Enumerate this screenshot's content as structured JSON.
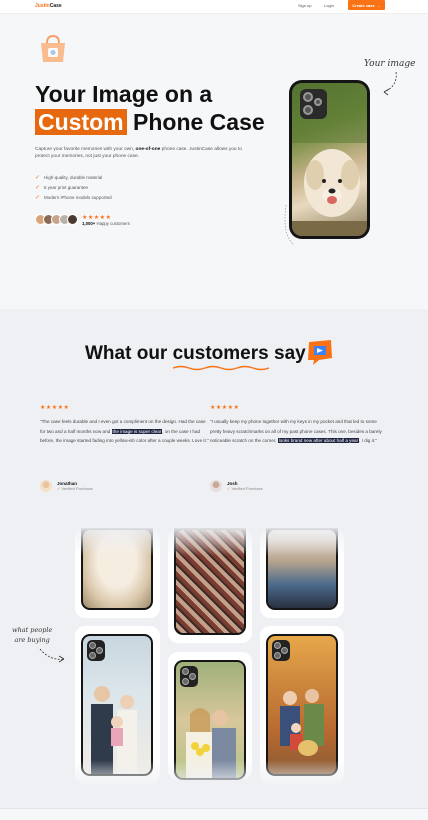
{
  "nav": {
    "logo_a": "Justin",
    "logo_b": "Case",
    "signup": "Sign up",
    "login": "Login",
    "cta": "Create case"
  },
  "hero": {
    "title_line1": "Your Image on a",
    "title_highlight": "Custom",
    "title_line2_rest": "Phone Case",
    "desc_pre": "Capture your favorite memories with your own,",
    "desc_bold": "one-of-one",
    "desc_post": "phone case. JustinCase allows you to protect your memories, not just your phone case.",
    "features": [
      "High-quality, durable material",
      "5 year print guarantee",
      "Modern iPhone models supported"
    ],
    "stars": "★★★★★",
    "happy_bold": "1,000+",
    "happy_rest": "Happy customers",
    "annotation": "Your image"
  },
  "reviews": {
    "heading_pre": "What our",
    "heading_accent": "customers",
    "heading_post": "say",
    "items": [
      {
        "stars": "★★★★★",
        "text_pre": "\"The case feels durable and I even got a compliment on the design. Had the case for two and a half months now and",
        "text_mark": "the image is super clear",
        "text_post": ", on the case I had before, the image started fading into yellow-ish color after a couple weeks. Love it.\"",
        "name": "Jonathan",
        "verified": "Verified Purchase"
      },
      {
        "stars": "★★★★★",
        "text_pre": "\"I usually keep my phone together with my keys in my pocket and that led to some pretty heavy scratchmarks on all of my past phone cases. This one, besides a barely noticeable scratch on the corner,",
        "text_mark": "looks brand new after about half a year",
        "text_post": ". I dig it.\"",
        "name": "Josh",
        "verified": "Verified Purchase"
      }
    ],
    "buying_annotation_1": "what people",
    "buying_annotation_2": "are buying"
  },
  "colors": {
    "accent": "#f97316",
    "highlight": "#e6690f",
    "mark": "#1e2440"
  }
}
